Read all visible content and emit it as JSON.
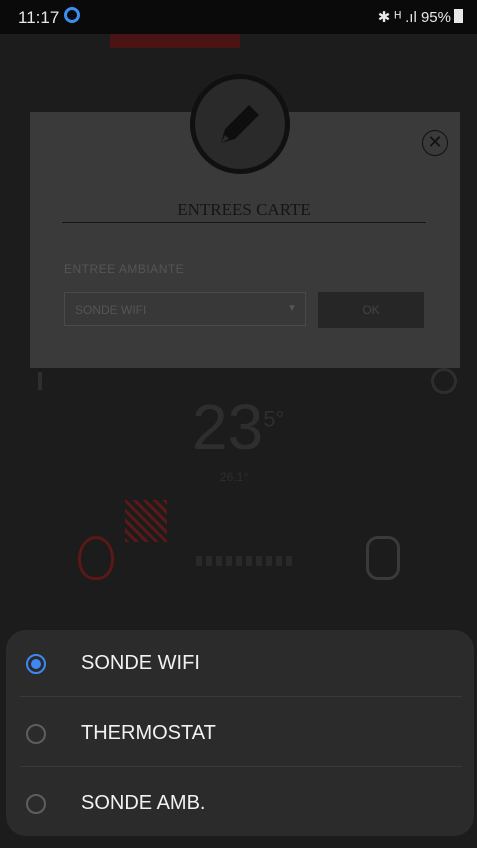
{
  "status_bar": {
    "time": "11:17",
    "signal": "✱ ᴴ .ıl",
    "battery_percent": "95%"
  },
  "dialog": {
    "title": "ENTREES CARTE",
    "field_label": "ENTREE AMBIANTE",
    "select_value": "SONDE WIFI",
    "ok_label": "OK"
  },
  "background": {
    "temperature": "23",
    "temperature_decimal": "5°",
    "sub_temperature": "26.1°"
  },
  "bottom_sheet": {
    "options": [
      {
        "label": "SONDE WIFI",
        "selected": true
      },
      {
        "label": "THERMOSTAT",
        "selected": false
      },
      {
        "label": "SONDE AMB.",
        "selected": false
      }
    ]
  },
  "colors": {
    "accent": "#3d88f2",
    "background": "#1c1c1c",
    "sheet": "#2b2b2b"
  }
}
